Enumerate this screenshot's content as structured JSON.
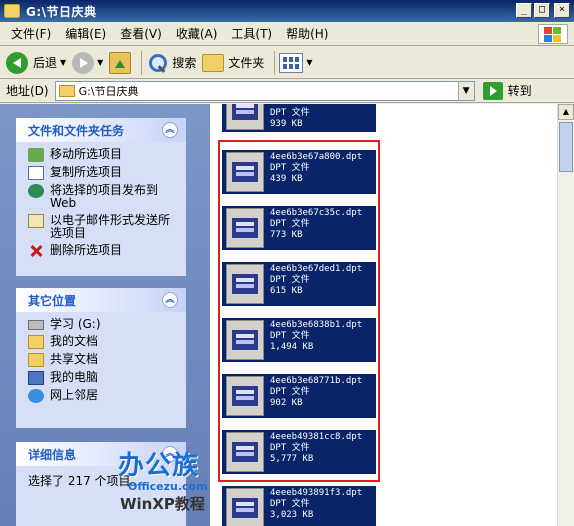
{
  "window": {
    "title": "G:\\节日庆典",
    "min_label": "_",
    "max_label": "□",
    "close_label": "×"
  },
  "menu": [
    "文件(F)",
    "编辑(E)",
    "查看(V)",
    "收藏(A)",
    "工具(T)",
    "帮助(H)"
  ],
  "toolbar": {
    "back_label": "后退",
    "search_label": "搜索",
    "folders_label": "文件夹"
  },
  "address": {
    "label": "地址(D)",
    "value": "G:\\节日庆典",
    "go_label": "转到"
  },
  "tasks": {
    "title": "文件和文件夹任务",
    "items": [
      "移动所选项目",
      "复制所选项目",
      "将选择的项目发布到 Web",
      "以电子邮件形式发送所选项目",
      "删除所选项目"
    ]
  },
  "other_places": {
    "title": "其它位置",
    "items": [
      "学习 (G:)",
      "我的文档",
      "共享文档",
      "我的电脑",
      "网上邻居"
    ]
  },
  "details": {
    "title": "详细信息",
    "text": "选择了 217 个项目。"
  },
  "files": [
    {
      "name": "4ee6b3e67a800.dpt",
      "type": "DPT 文件",
      "size": "439 KB"
    },
    {
      "name": "4ee6b3e67c35c.dpt",
      "type": "DPT 文件",
      "size": "773 KB"
    },
    {
      "name": "4ee6b3e67ded1.dpt",
      "type": "DPT 文件",
      "size": "615 KB"
    },
    {
      "name": "4ee6b3e6838b1.dpt",
      "type": "DPT 文件",
      "size": "1,494 KB"
    },
    {
      "name": "4ee6b3e68771b.dpt",
      "type": "DPT 文件",
      "size": "902 KB"
    },
    {
      "name": "4eeeb49381cc8.dpt",
      "type": "DPT 文件",
      "size": "5,777 KB"
    },
    {
      "name": "4eeeb493891f3.dpt",
      "type": "DPT 文件",
      "size": "3,023 KB"
    }
  ],
  "top_partial_file": {
    "type": "DPT 文件",
    "size": "939 KB"
  },
  "watermark": {
    "line1": "办公族",
    "line2": "Officezu.com",
    "line3": "WinXP教程"
  }
}
